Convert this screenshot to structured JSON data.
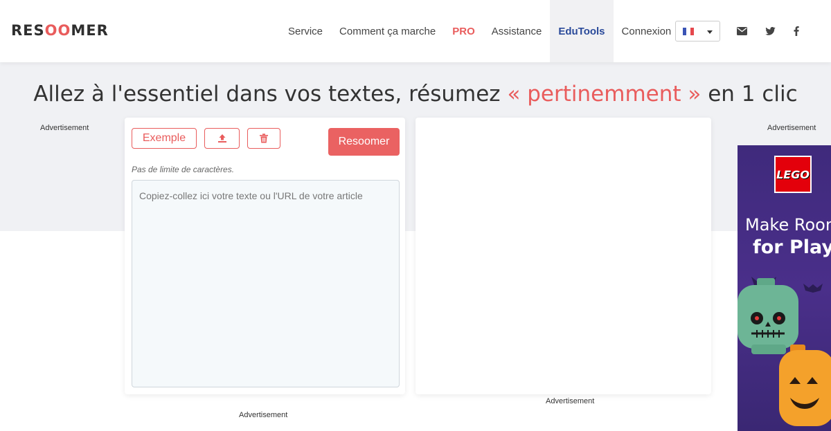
{
  "logo": {
    "part1": "RES",
    "part2": "OO",
    "part3": "MER"
  },
  "nav": {
    "items": [
      {
        "label": "Service"
      },
      {
        "label": "Comment ça marche"
      },
      {
        "label": "PRO"
      },
      {
        "label": "Assistance"
      },
      {
        "label": "EduTools"
      },
      {
        "label": "Connexion"
      }
    ],
    "language": "fr"
  },
  "icons": {
    "mail": "mail-icon",
    "twitter": "twitter-icon",
    "facebook": "facebook-icon"
  },
  "headline": {
    "before": "Allez à l'essentiel dans vos textes, résumez",
    "accent": "« pertinemment »",
    "after": "en 1 clic"
  },
  "toolbar": {
    "example_label": "Exemple",
    "upload_icon": "upload-icon",
    "delete_icon": "trash-icon",
    "submit_label": "Resoomer"
  },
  "input": {
    "hint": "Pas de limite de caractères.",
    "placeholder": "Copiez-collez ici votre texte ou l'URL de votre article",
    "value": ""
  },
  "ads": {
    "left_label": "Advertisement",
    "right_label": "Advertisement",
    "below_input_label": "Advertisement",
    "below_output_label": "Advertisement",
    "banner": {
      "brand": "LEGO",
      "line1": "Make Room",
      "line2": "for Play"
    }
  },
  "colors": {
    "accent": "#e95c5c",
    "edutools": "#2a4a9a",
    "hero_bg": "#f0f1f4",
    "ad_bg": "#3f2a7c"
  }
}
